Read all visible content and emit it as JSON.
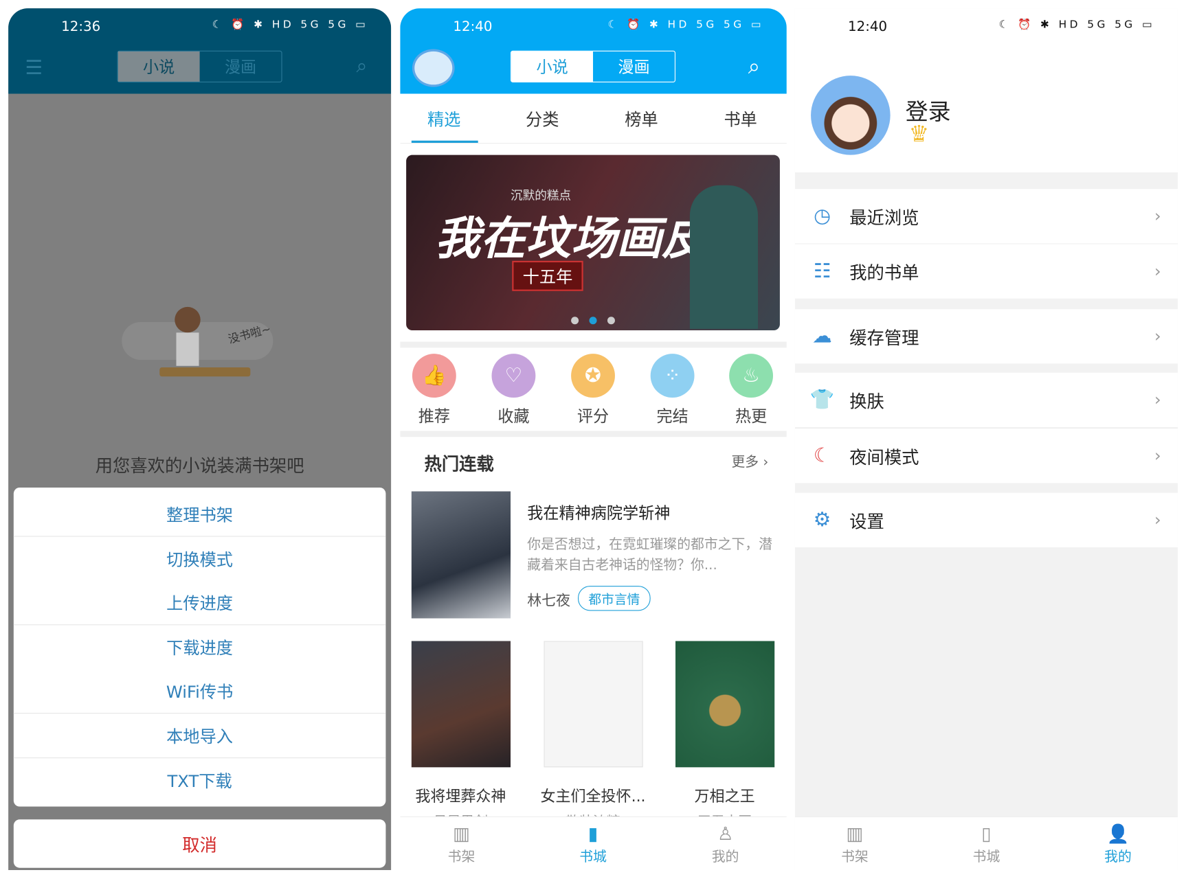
{
  "colors": {
    "shelf_header": "#00506e",
    "store_header": "#03a9f4",
    "accent": "#1e9fd8",
    "sheet_text": "#2f7fb8",
    "cancel": "#d22a2a"
  },
  "shelf": {
    "status_time": "12:36",
    "status_icons": "☾ ⏰ ✱ HD 5G 5G ▭",
    "segment": [
      "小说",
      "漫画"
    ],
    "empty_text": "用您喜欢的小说装满书架吧",
    "illustration_text": "没书啦~",
    "sheet_items": [
      "整理书架",
      "切换模式",
      "上传进度",
      "下载进度",
      "WiFi传书",
      "本地导入",
      "TXT下载"
    ],
    "cancel": "取消"
  },
  "store": {
    "status_time": "12:40",
    "status_icons": "☾ ⏰ ✱ HD 5G 5G ▭",
    "segment": [
      "小说",
      "漫画"
    ],
    "tabs": [
      "精选",
      "分类",
      "榜单",
      "书单"
    ],
    "banner": {
      "subtitle": "沉默的糕点",
      "title": "我在坟场画皮",
      "badge": "十五年",
      "dots": 3,
      "active_dot": 2
    },
    "quick": [
      {
        "label": "推荐",
        "icon": "thumb-up-icon",
        "color": "#f29a9a"
      },
      {
        "label": "收藏",
        "icon": "heart-icon",
        "color": "#c6a3dc"
      },
      {
        "label": "评分",
        "icon": "medal-icon",
        "color": "#f7c066"
      },
      {
        "label": "完结",
        "icon": "grid-icon",
        "color": "#8fd0f2"
      },
      {
        "label": "热更",
        "icon": "flame-icon",
        "color": "#8ddfae"
      }
    ],
    "section_title": "热门连载",
    "more": "更多",
    "featured": {
      "title": "我在精神病院学斩神",
      "desc": "你是否想过，在霓虹璀璨的都市之下，潜藏着来自古老神话的怪物？你...",
      "author": "林七夜",
      "tag": "都市言情"
    },
    "grid": [
      {
        "title": "我将埋葬众神",
        "author": "贝昇思剑"
      },
      {
        "title": "女主们全投怀...",
        "author": "散装浓糖"
      },
      {
        "title": "万相之王",
        "author": "天蚕土豆"
      }
    ],
    "nav": [
      "书架",
      "书城",
      "我的"
    ]
  },
  "mine": {
    "status_time": "12:40",
    "status_icons": "☾ ⏰ ✱ HD 5G 5G ▭",
    "login": "登录",
    "vip": "VIP",
    "items": [
      {
        "label": "最近浏览",
        "icon": "clock-icon"
      },
      {
        "label": "我的书单",
        "icon": "list-icon"
      },
      {
        "label": "缓存管理",
        "icon": "cloud-icon"
      },
      {
        "label": "换肤",
        "icon": "shirt-icon"
      },
      {
        "label": "夜间模式",
        "icon": "moon-icon"
      },
      {
        "label": "设置",
        "icon": "gear-icon"
      }
    ],
    "nav": [
      "书架",
      "书城",
      "我的"
    ]
  }
}
